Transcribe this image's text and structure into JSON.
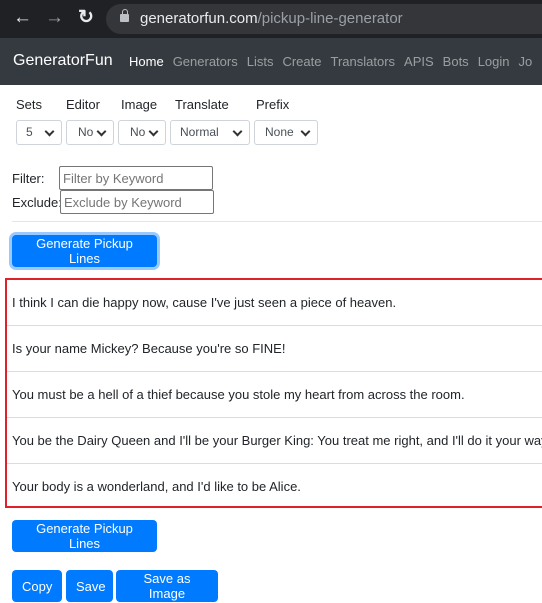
{
  "browser": {
    "url_domain": "generatorfun.com",
    "url_path": "/pickup-line-generator"
  },
  "navbar": {
    "brand": "GeneratorFun",
    "links": [
      "Home",
      "Generators",
      "Lists",
      "Create",
      "Translators",
      "APIS",
      "Bots",
      "Login",
      "Jo"
    ]
  },
  "options": [
    {
      "label": "Sets",
      "value": "5"
    },
    {
      "label": "Editor",
      "value": "No"
    },
    {
      "label": "Image",
      "value": "No"
    },
    {
      "label": "Translate",
      "value": "Normal"
    },
    {
      "label": "Prefix",
      "value": "None"
    }
  ],
  "filter": {
    "label": "Filter:",
    "placeholder": "Filter by Keyword"
  },
  "exclude": {
    "label": "Exclude:",
    "placeholder": "Exclude by Keyword"
  },
  "generate_label": "Generate Pickup Lines",
  "lines": [
    "I think I can die happy now, cause I've just seen a piece of heaven.",
    "Is your name Mickey? Because you're so FINE!",
    "You must be a hell of a thief because you stole my heart from across the room.",
    "You be the Dairy Queen and I'll be your Burger King: You treat me right, and I'll do it your way.",
    "Your body is a wonderland, and I'd like to be Alice."
  ],
  "actions": {
    "copy": "Copy",
    "save": "Save",
    "save_image": "Save as Image"
  },
  "colors": {
    "primary": "#007bff",
    "navbar": "#343a40",
    "highlight": "#e0202a"
  }
}
